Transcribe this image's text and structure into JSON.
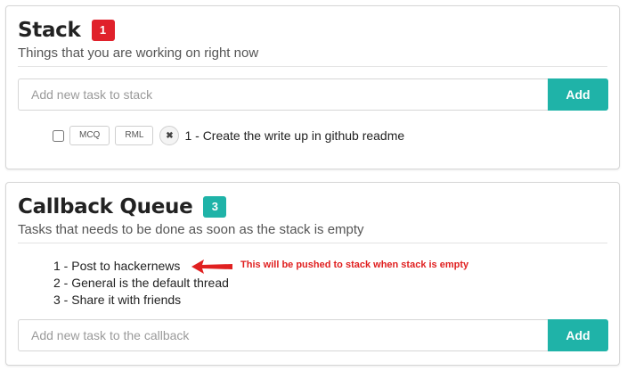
{
  "stack": {
    "title": "Stack",
    "count": "1",
    "subtitle": "Things that you are working on right now",
    "input_placeholder": "Add new task to stack",
    "add_label": "Add",
    "tasks": [
      {
        "tags": [
          "MCQ",
          "RML"
        ],
        "remove_glyph": "✖",
        "text": "1 - Create the write up in github readme"
      }
    ]
  },
  "callback": {
    "title": "Callback Queue",
    "count": "3",
    "subtitle": "Tasks that needs to be done as soon as the stack is empty",
    "items": [
      "1 - Post to hackernews",
      "2 - General is the default thread",
      "3 - Share it with friends"
    ],
    "annotation": "This will be pushed to stack when stack is empty",
    "input_placeholder": "Add new task to the callback",
    "add_label": "Add"
  },
  "colors": {
    "accent": "#1fb3a8",
    "stack_badge": "#e0212b",
    "annotation": "#e02020"
  },
  "icons": {
    "remove": "close-icon",
    "annotation_arrow": "arrow-left-icon"
  }
}
